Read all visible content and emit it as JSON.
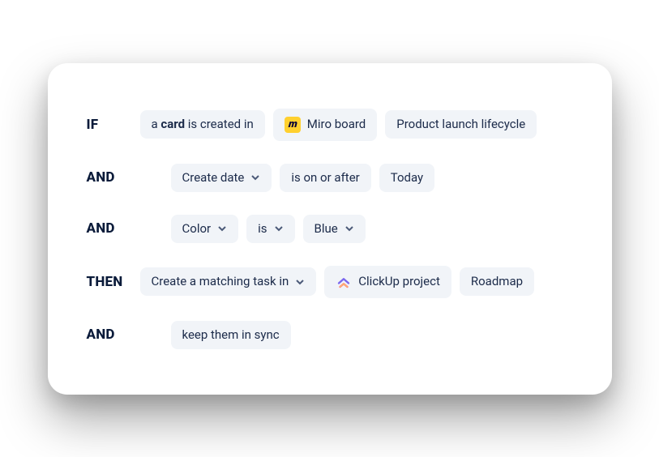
{
  "rows": {
    "r1": {
      "keyword": "IF",
      "trigger_prefix": "a ",
      "trigger_bold": "card",
      "trigger_suffix": " is created in",
      "source_app": "Miro board",
      "source_location": "Product launch lifecycle"
    },
    "r2": {
      "keyword": "AND",
      "field": "Create date",
      "operator": "is on or after",
      "value": "Today"
    },
    "r3": {
      "keyword": "AND",
      "field": "Color",
      "operator": "is",
      "value": "Blue"
    },
    "r4": {
      "keyword": "THEN",
      "action": "Create a matching task in",
      "target_app": "ClickUp project",
      "target_location": "Roadmap"
    },
    "r5": {
      "keyword": "AND",
      "action": "keep them in sync"
    }
  }
}
